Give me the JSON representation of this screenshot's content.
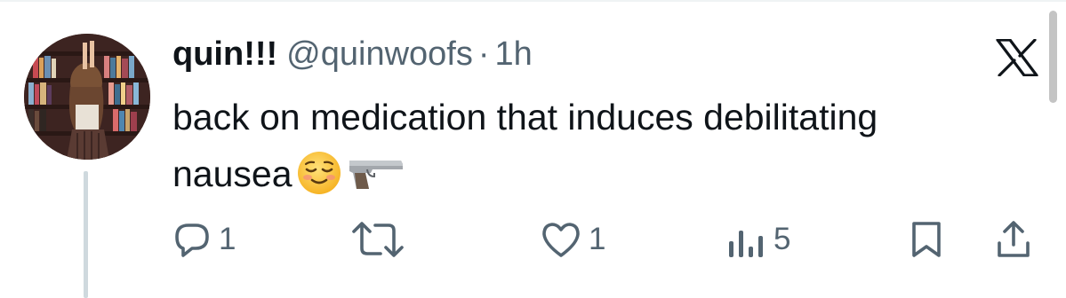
{
  "tweet": {
    "display_name": "quin!!!",
    "handle": "@quinwoofs",
    "separator": "·",
    "time": "1h",
    "text_line1": "back on medication that induces debilitating",
    "text_line2": "nausea",
    "emojis": [
      "relieved-face",
      "pistol"
    ]
  },
  "actions": {
    "replies": "1",
    "retweets": "",
    "likes": "1",
    "views": "5"
  },
  "colors": {
    "text": "#0f1419",
    "secondary": "#536471",
    "thread_line": "#cfd9de"
  },
  "icons": [
    "x-logo-icon",
    "reply-icon",
    "retweet-icon",
    "like-icon",
    "views-icon",
    "bookmark-icon",
    "share-icon"
  ]
}
